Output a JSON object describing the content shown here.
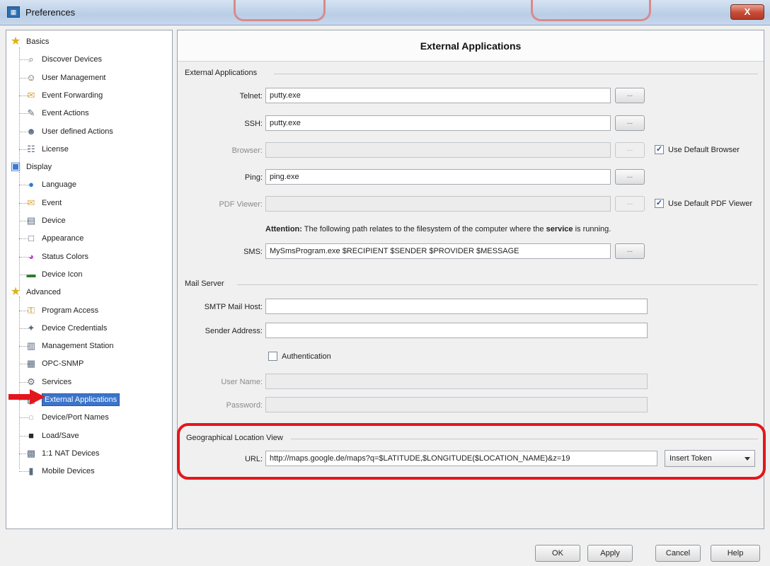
{
  "window": {
    "title": "Preferences",
    "close_label": "X"
  },
  "tree": [
    {
      "label": "Basics",
      "kind": "category",
      "icon": "star-icon"
    },
    {
      "label": "Discover Devices",
      "kind": "item",
      "icon": "magnifier-icon"
    },
    {
      "label": "User Management",
      "kind": "item",
      "icon": "users-icon"
    },
    {
      "label": "Event Forwarding",
      "kind": "item",
      "icon": "envelope-icon"
    },
    {
      "label": "Event Actions",
      "kind": "item",
      "icon": "action-icon"
    },
    {
      "label": "User defined Actions",
      "kind": "item",
      "icon": "user-actions-icon"
    },
    {
      "label": "License",
      "kind": "item",
      "icon": "license-icon"
    },
    {
      "label": "Display",
      "kind": "category",
      "icon": "display-icon"
    },
    {
      "label": "Language",
      "kind": "item",
      "icon": "globe-icon"
    },
    {
      "label": "Event",
      "kind": "item",
      "icon": "envelope-icon"
    },
    {
      "label": "Device",
      "kind": "item",
      "icon": "device-icon"
    },
    {
      "label": "Appearance",
      "kind": "item",
      "icon": "appearance-icon"
    },
    {
      "label": "Status Colors",
      "kind": "item",
      "icon": "colors-icon"
    },
    {
      "label": "Device Icon",
      "kind": "item",
      "icon": "device-icon-icon"
    },
    {
      "label": "Advanced",
      "kind": "category",
      "icon": "star-icon"
    },
    {
      "label": "Program Access",
      "kind": "item",
      "icon": "key-icon"
    },
    {
      "label": "Device Credentials",
      "kind": "item",
      "icon": "credentials-icon"
    },
    {
      "label": "Management Station",
      "kind": "item",
      "icon": "station-icon"
    },
    {
      "label": "OPC-SNMP",
      "kind": "item",
      "icon": "opc-icon"
    },
    {
      "label": "Services",
      "kind": "item",
      "icon": "services-icon"
    },
    {
      "label": "External Applications",
      "kind": "item",
      "icon": "external-apps-icon",
      "selected": true
    },
    {
      "label": "Device/Port Names",
      "kind": "item",
      "icon": "names-icon"
    },
    {
      "label": "Load/Save",
      "kind": "item",
      "icon": "save-icon"
    },
    {
      "label": "1:1 NAT Devices",
      "kind": "item",
      "icon": "nat-icon"
    },
    {
      "label": "Mobile Devices",
      "kind": "item",
      "icon": "mobile-icon"
    }
  ],
  "panel": {
    "header": "External Applications",
    "ext_apps": {
      "title": "External Applications",
      "telnet": {
        "label": "Telnet:",
        "value": "putty.exe"
      },
      "ssh": {
        "label": "SSH:",
        "value": "putty.exe"
      },
      "browser": {
        "label": "Browser:",
        "value": ""
      },
      "ping": {
        "label": "Ping:",
        "value": "ping.exe"
      },
      "pdf": {
        "label": "PDF Viewer:",
        "value": ""
      },
      "browse_label": "...",
      "use_default_browser": "Use Default Browser",
      "use_default_pdf": "Use Default PDF Viewer",
      "attention_prefix": "Attention:",
      "attention_mid": " The following path relates to the filesystem of the computer where the ",
      "attention_bold": "service",
      "attention_suffix": " is running.",
      "sms": {
        "label": "SMS:",
        "value": "MySmsProgram.exe $RECIPIENT $SENDER $PROVIDER $MESSAGE"
      }
    },
    "mail": {
      "title": "Mail Server",
      "smtp": {
        "label": "SMTP Mail Host:",
        "value": ""
      },
      "sender": {
        "label": "Sender Address:",
        "value": ""
      },
      "auth": "Authentication",
      "user": {
        "label": "User Name:",
        "value": ""
      },
      "password": {
        "label": "Password:",
        "value": ""
      }
    },
    "geo": {
      "title": "Geographical Location View",
      "url": {
        "label": "URL:",
        "value": "http://maps.google.de/maps?q=$LATITUDE,$LONGITUDE($LOCATION_NAME)&z=19"
      },
      "token": "Insert Token"
    }
  },
  "buttons": {
    "ok": "OK",
    "apply": "Apply",
    "cancel": "Cancel",
    "help": "Help"
  }
}
